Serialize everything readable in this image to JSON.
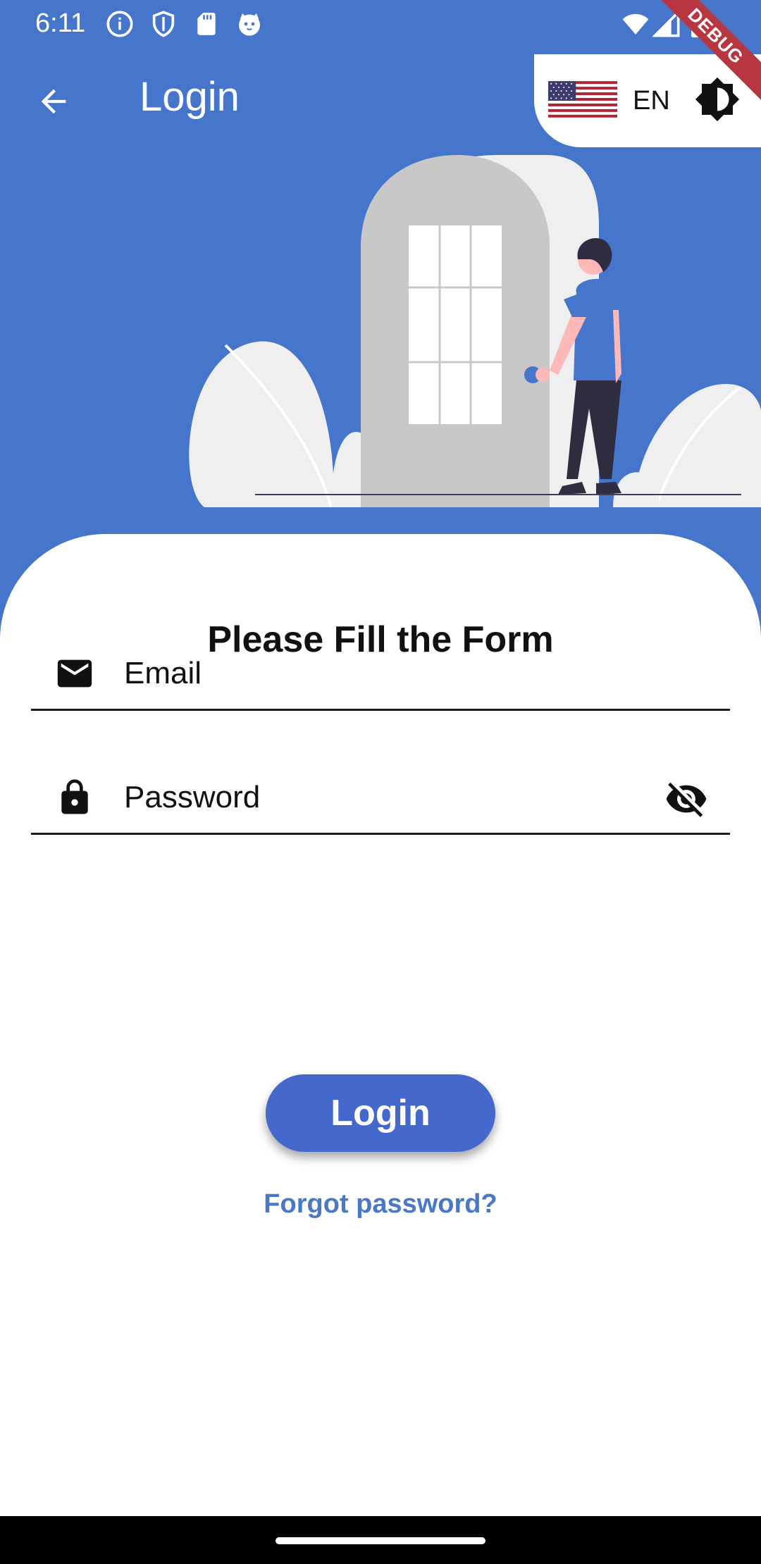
{
  "status_bar": {
    "time": "6:11",
    "left_icons": [
      "info-icon",
      "shield-icon",
      "sd-card-icon",
      "cat-icon"
    ],
    "right_icons": [
      "wifi-icon",
      "signal-icon",
      "battery-icon"
    ]
  },
  "debug_banner": "DEBUG",
  "app_bar": {
    "back_icon": "arrow-back-icon",
    "title": "Login"
  },
  "settings": {
    "flag": "us-flag-icon",
    "language": "EN",
    "theme_icon": "brightness-icon"
  },
  "form": {
    "title": "Please Fill the Form",
    "email": {
      "icon": "mail-icon",
      "placeholder": "Email",
      "value": ""
    },
    "password": {
      "icon": "lock-icon",
      "placeholder": "Password",
      "value": "",
      "visibility_icon": "visibility-off-icon"
    },
    "login_label": "Login",
    "forgot_label": "Forgot password?"
  },
  "colors": {
    "primary": "#4676cc",
    "button": "#4568cc",
    "link": "#4a78c8",
    "debug": "#b83640"
  }
}
